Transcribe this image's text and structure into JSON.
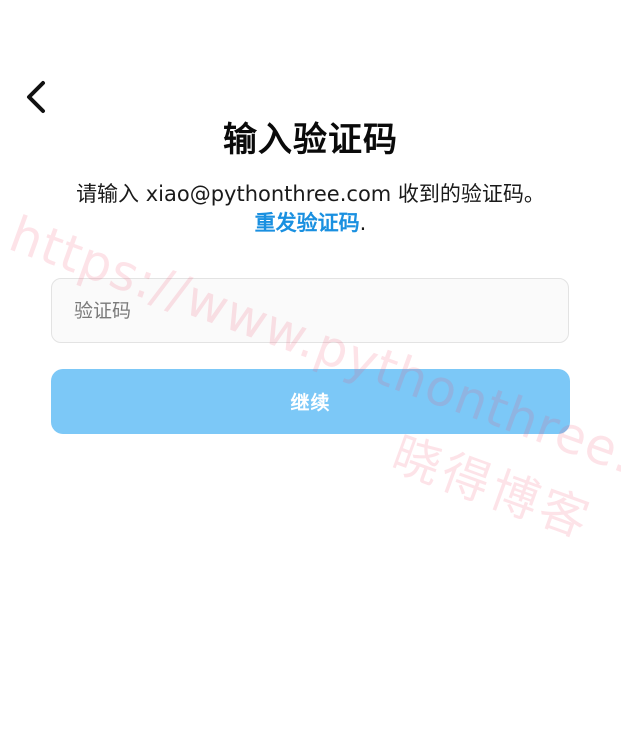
{
  "header": {
    "back_icon": "chevron-left-icon"
  },
  "main": {
    "title": "输入验证码",
    "instruction_prefix": "请输入 xiao@pythonthree.com 收到的验证码。",
    "resend_label": "重发验证码",
    "resend_suffix": ".",
    "code_input": {
      "placeholder": "验证码",
      "value": ""
    },
    "continue_label": "继续"
  },
  "watermark": {
    "url_text": "https://www.pythonthree.com",
    "brand_text": "晓得博客"
  },
  "colors": {
    "link": "#1a90e0",
    "button_bg": "#7cc8f7",
    "input_bg": "#fafafa",
    "watermark": "#f0506e"
  }
}
